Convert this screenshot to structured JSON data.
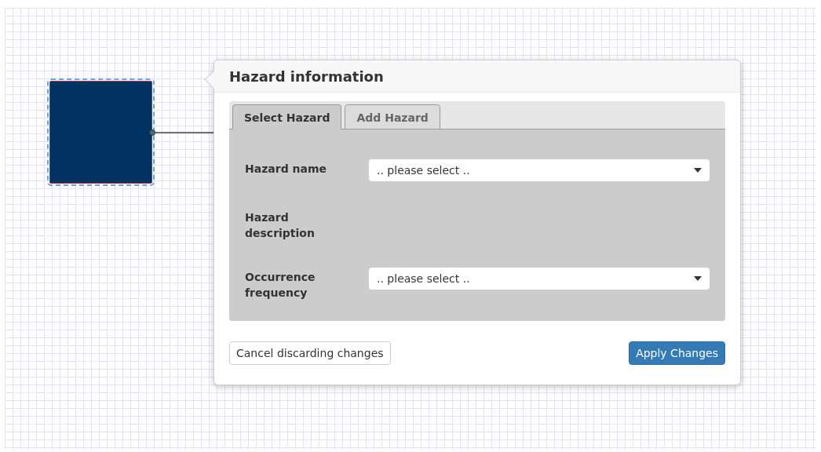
{
  "canvas": {
    "node": {
      "selected": true
    }
  },
  "popover": {
    "title": "Hazard information",
    "tabs": [
      {
        "label": "Select Hazard",
        "selected": true
      },
      {
        "label": "Add Hazard",
        "selected": false
      }
    ],
    "fields": [
      {
        "label": "Hazard name",
        "kind": "select",
        "value": ".. please select .."
      },
      {
        "label": "Hazard description",
        "kind": "static"
      },
      {
        "label": "Occurrence frequency",
        "kind": "select",
        "value": ".. please select .."
      }
    ],
    "buttons": [
      {
        "label": "Cancel discarding changes",
        "kind": "default"
      },
      {
        "label": "Apply Changes",
        "kind": "primary"
      }
    ]
  }
}
